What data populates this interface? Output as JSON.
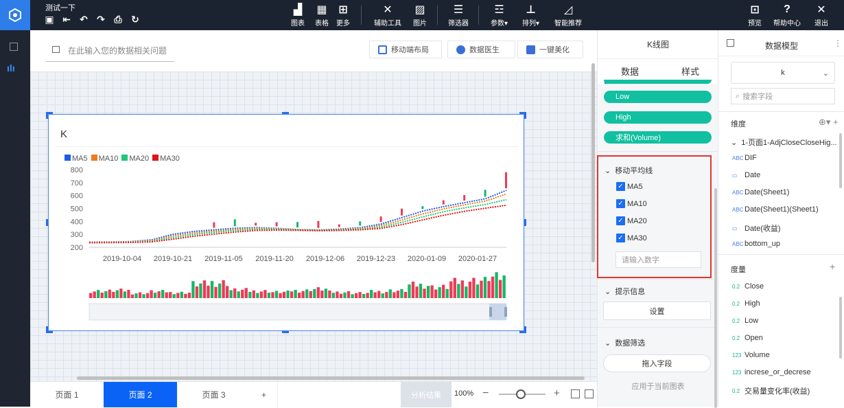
{
  "header": {
    "doc_title": "测试一下",
    "toolbar": [
      {
        "key": "chart",
        "label": "图表",
        "icon": "bar-chart-icon"
      },
      {
        "key": "table",
        "label": "表格",
        "icon": "table-icon"
      },
      {
        "key": "more",
        "label": "更多",
        "icon": "grid-icon"
      },
      {
        "key": "aux",
        "label": "辅助工具",
        "icon": "tools-icon"
      },
      {
        "key": "image",
        "label": "图片",
        "icon": "image-icon"
      },
      {
        "key": "filter",
        "label": "筛选器",
        "icon": "filter-icon"
      },
      {
        "key": "param",
        "label": "参数▾",
        "icon": "param-icon"
      },
      {
        "key": "arrange",
        "label": "排列▾",
        "icon": "arrange-icon"
      },
      {
        "key": "smart",
        "label": "智能推荐",
        "icon": "smart-icon"
      }
    ],
    "right_actions": [
      {
        "key": "preview",
        "label": "预览",
        "icon": "preview-icon"
      },
      {
        "key": "help",
        "label": "帮助中心",
        "icon": "help-icon"
      },
      {
        "key": "exit",
        "label": "退出",
        "icon": "close-icon"
      }
    ]
  },
  "ask": {
    "placeholder": "在此输入您的数据相关问题"
  },
  "action_pills": [
    {
      "label": "移动端布局"
    },
    {
      "label": "数据医生"
    },
    {
      "label": "一键美化"
    }
  ],
  "widget": {
    "title": "K"
  },
  "chart_data": {
    "type": "line",
    "title": "K",
    "legend": [
      "MA5",
      "MA10",
      "MA20",
      "MA30"
    ],
    "colors": {
      "MA5": "#1a5ee6",
      "MA10": "#f27a1e",
      "MA20": "#1ec878",
      "MA30": "#e01515",
      "up": "#ef3a55",
      "down": "#14b866"
    },
    "y_ticks": [
      200,
      300,
      400,
      500,
      600,
      700,
      800
    ],
    "ylim": [
      200,
      800
    ],
    "x_ticks": [
      "2019-10-04",
      "2019-10-21",
      "2019-11-05",
      "2019-11-20",
      "2019-12-06",
      "2019-12-23",
      "2020-01-09",
      "2020-01-27"
    ],
    "series": [
      {
        "name": "MA5",
        "values": [
          240,
          241,
          244,
          258,
          300,
          322,
          335,
          347,
          352,
          346,
          337,
          334,
          340,
          352,
          380,
          430,
          480,
          515,
          545,
          575,
          640
        ]
      },
      {
        "name": "MA10",
        "values": [
          238,
          239,
          241,
          252,
          288,
          310,
          325,
          339,
          346,
          343,
          336,
          333,
          336,
          346,
          368,
          412,
          458,
          497,
          528,
          557,
          612
        ]
      },
      {
        "name": "MA20",
        "values": [
          236,
          237,
          238,
          247,
          275,
          298,
          315,
          330,
          339,
          339,
          334,
          331,
          333,
          340,
          356,
          394,
          435,
          475,
          505,
          532,
          568
        ]
      },
      {
        "name": "MA30",
        "values": [
          235,
          236,
          237,
          242,
          262,
          285,
          302,
          318,
          330,
          333,
          331,
          328,
          330,
          335,
          346,
          376,
          412,
          448,
          478,
          502,
          525
        ]
      }
    ],
    "volume": [
      0.14,
      0.15,
      0.1,
      0.13,
      0.11,
      0.28,
      0.31,
      0.16,
      0.14,
      0.12,
      0.15,
      0.18,
      0.12,
      0.1,
      0.13,
      0.15,
      0.26,
      0.22,
      0.32,
      0.35,
      0.41
    ]
  },
  "config": {
    "title": "K线图",
    "tabs": [
      "数据",
      "样式"
    ],
    "fields": [
      "Low",
      "High",
      "求和(Volume)"
    ],
    "ma_section": "移动平均线",
    "ma_items": [
      "MA5",
      "MA10",
      "MA20",
      "MA30"
    ],
    "ma_placeholder": "请输入数字",
    "tooltip_section": "提示信息",
    "tooltip_button": "设置",
    "filter_section": "数据筛选",
    "drag_button": "拖入字段",
    "apply_label": "应用于当前图表"
  },
  "model": {
    "title": "数据模型",
    "dataset": "k",
    "search_placeholder": "搜索字段",
    "dim_label": "维度",
    "group": "1-页面1-AdjCloseCloseHig...",
    "dims": [
      {
        "tag": "ABC",
        "label": "DIF"
      },
      {
        "tag": "cal",
        "label": "Date"
      },
      {
        "tag": "ABC",
        "label": "Date(Sheet1)"
      },
      {
        "tag": "ABC",
        "label": "Date(Sheet1)(Sheet1)"
      },
      {
        "tag": "cal",
        "label": "Date(收益)"
      },
      {
        "tag": "ABC",
        "label": "bottom_up"
      }
    ],
    "measure_label": "度量",
    "measures": [
      {
        "tag": "0.2",
        "label": "Close"
      },
      {
        "tag": "0.2",
        "label": "High"
      },
      {
        "tag": "0.2",
        "label": "Low"
      },
      {
        "tag": "0.2",
        "label": "Open"
      },
      {
        "tag": "123",
        "label": "Volume"
      },
      {
        "tag": "123",
        "label": "increse_or_decrese"
      },
      {
        "tag": "0.2",
        "label": "交易量变化率(收益)"
      }
    ]
  },
  "pages": {
    "tabs": [
      "页面 1",
      "页面 2",
      "页面 3"
    ],
    "add": "+",
    "analysis": "分析结果",
    "zoom": "100%"
  }
}
